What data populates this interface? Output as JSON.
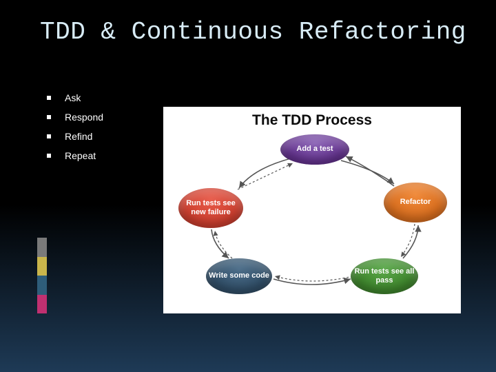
{
  "title": "TDD & Continuous Refactoring",
  "bullets": [
    "Ask",
    "Respond",
    "Refind",
    "Repeat"
  ],
  "diagram": {
    "title": "The TDD Process",
    "nodes": {
      "add": "Add a test",
      "fail": "Run tests see new failure",
      "refactor": "Refactor",
      "write": "Write some code",
      "pass": "Run tests see all pass"
    }
  }
}
